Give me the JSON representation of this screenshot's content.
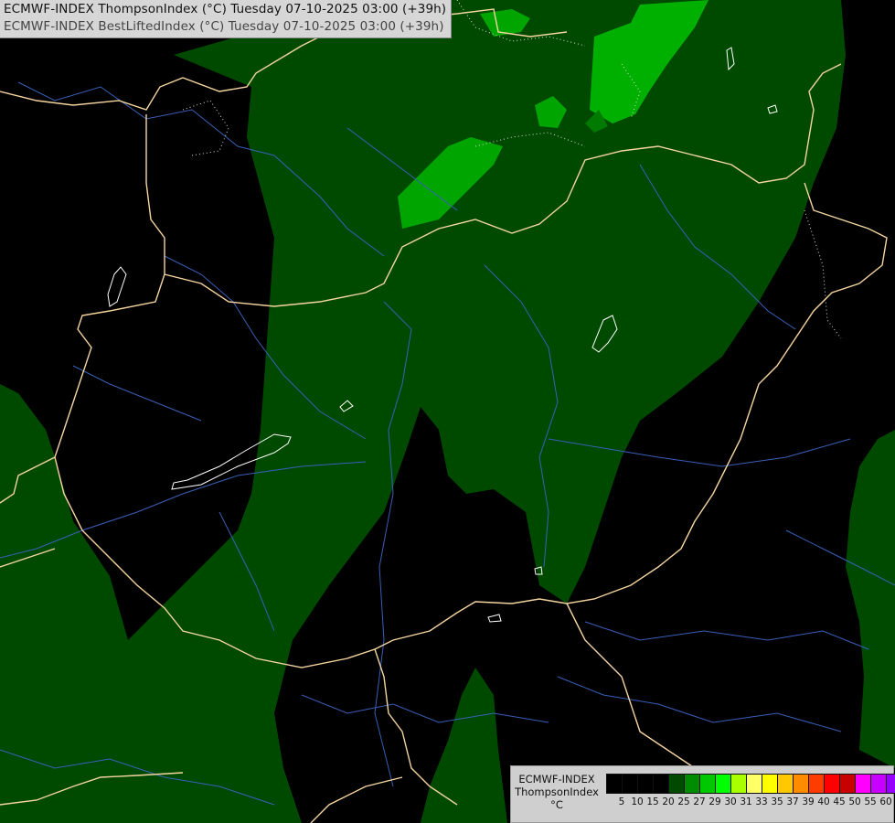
{
  "title": {
    "line1": "ECMWF-INDEX ThompsonIndex (°C) Tuesday 07-10-2025 03:00 (+39h)",
    "line2": "ECMWF-INDEX BestLiftedIndex (°C) Tuesday 07-10-2025 03:00 (+39h)"
  },
  "legend": {
    "model": "ECMWF-INDEX",
    "parameter": "ThompsonIndex",
    "unit": "°C",
    "colors": [
      "#000000",
      "#000000",
      "#000000",
      "#000000",
      "#004a00",
      "#008c00",
      "#00c800",
      "#00ff00",
      "#aaff00",
      "#ffff66",
      "#ffff00",
      "#ffc800",
      "#ff8c00",
      "#ff3c00",
      "#ff0000",
      "#c80000",
      "#ff00ff",
      "#c800ff",
      "#9600ff",
      "#6400ff",
      "#0000ff"
    ],
    "ticks": [
      "5",
      "10",
      "15",
      "20",
      "25",
      "27",
      "29",
      "30",
      "31",
      "33",
      "35",
      "37",
      "39",
      "40",
      "45",
      "50",
      "55",
      "60"
    ]
  },
  "colors": {
    "background": "#000000",
    "dark_green": "#004a00",
    "mid_green": "#008c00",
    "bright_green": "#00c800",
    "borders": "#f5d5a0",
    "rivers": "#3a5fb8",
    "lakes": "#ffffff"
  }
}
